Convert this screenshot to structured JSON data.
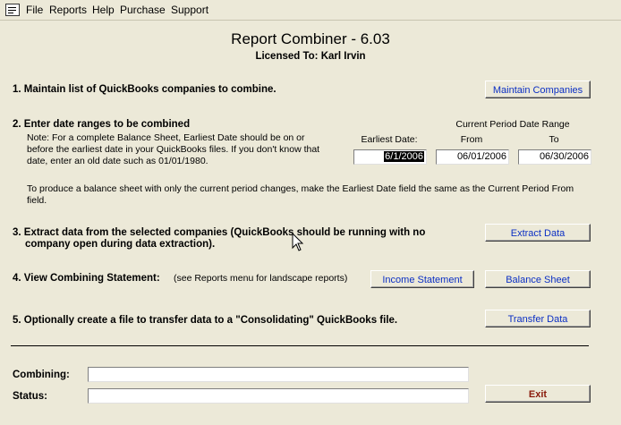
{
  "menu": {
    "items": [
      "File",
      "Reports",
      "Help",
      "Purchase",
      "Support"
    ]
  },
  "header": {
    "title": "Report Combiner - 6.03",
    "licensed": "Licensed To: Karl Irvin"
  },
  "step1": {
    "label": "1. Maintain list of QuickBooks companies to combine.",
    "button": "Maintain Companies"
  },
  "step2": {
    "label": "2. Enter date ranges to be combined",
    "note_line1": "Note: For  a complete Balance Sheet, Earliest Date should be on or",
    "note_line2": "before the earliest date in your QuickBooks files. If you don't know that",
    "note_line3": "date, enter an old date such as 01/01/1980.",
    "current_period_header": "Current Period Date Range",
    "earliest_label": "Earliest Date:",
    "from_label": "From",
    "to_label": "To",
    "earliest_value": "6/1/2006",
    "from_value": "06/01/2006",
    "to_value": "06/30/2006",
    "balance_note_line1": "To produce a balance sheet with only the current period changes, make the Earliest Date field the same as the Current Period From",
    "balance_note_line2": "field."
  },
  "step3": {
    "label_line1": "3. Extract data from the selected companies (QuickBooks should be running with no",
    "label_line2": "company open during data extraction).",
    "button": "Extract Data"
  },
  "step4": {
    "label": "4. View Combining Statement:",
    "hint": "(see Reports menu for landscape reports)",
    "income_button": "Income Statement",
    "balance_button": "Balance Sheet"
  },
  "step5": {
    "label": "5. Optionally create a file to transfer data to a \"Consolidating\" QuickBooks file.",
    "button": "Transfer Data"
  },
  "footer": {
    "combining_label": "Combining:",
    "combining_value": "",
    "status_label": "Status:",
    "status_value": "",
    "exit_button": "Exit"
  },
  "colors": {
    "background": "#ece9d8",
    "button_text": "#0b2fc4",
    "exit_text": "#8a1a0a"
  },
  "icons": [
    "app-icon",
    "mouse-cursor-icon"
  ]
}
